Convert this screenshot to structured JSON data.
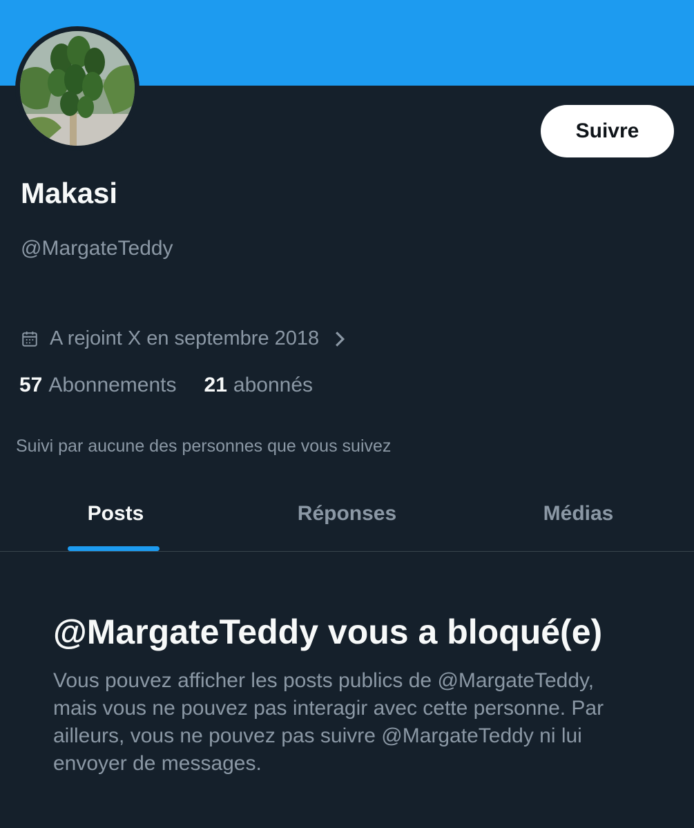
{
  "profile": {
    "display_name": "Makasi",
    "handle": "@MargateTeddy",
    "avatar_icon": "papaya-tree-photo",
    "follow_label": "Suivre",
    "joined": "A rejoint X en septembre 2018",
    "following_count": "57",
    "following_label": "Abonnements",
    "followers_count": "21",
    "followers_label": "abonnés",
    "followed_by": "Suivi par aucune des personnes que vous suivez"
  },
  "tabs": [
    {
      "label": "Posts",
      "active": true
    },
    {
      "label": "Réponses",
      "active": false
    },
    {
      "label": "Médias",
      "active": false
    }
  ],
  "blocked": {
    "title": "@MargateTeddy vous a bloqué(e)",
    "description": "Vous pouvez afficher les posts publics de @MargateTeddy, mais vous ne pouvez pas interagir avec cette personne. Par ailleurs, vous ne pouvez pas suivre @MargateTeddy ni lui envoyer de messages."
  },
  "colors": {
    "background": "#15202b",
    "banner": "#1d9bf0",
    "accent": "#1d9bf0",
    "primary_text": "#f7f9f9",
    "secondary_text": "#8b98a5"
  }
}
